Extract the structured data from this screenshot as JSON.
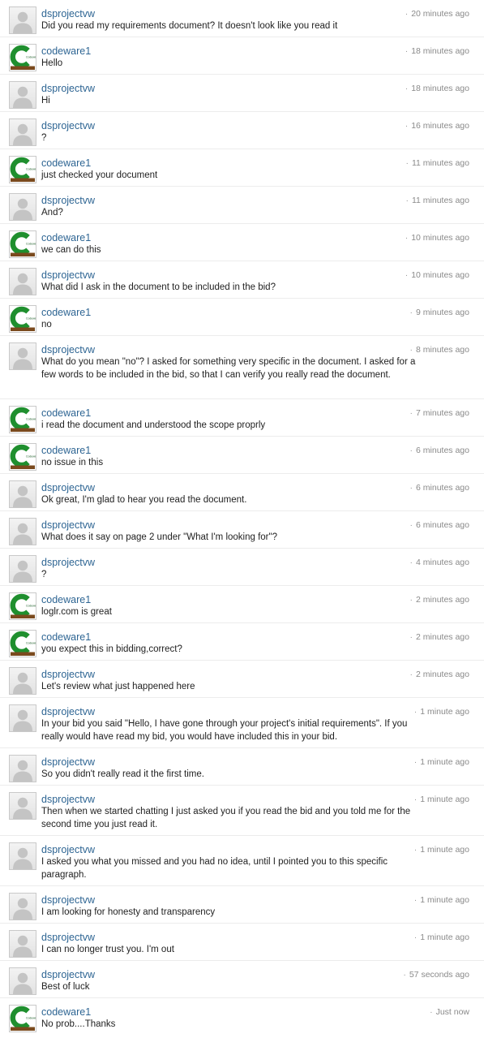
{
  "avatar_icons": {
    "dsprojectvw": "default-user-avatar-icon",
    "codeware1": "codeware-logo-avatar-icon"
  },
  "brand_colors": {
    "username_link": "#2e6593",
    "timestamp": "#8a8a8a",
    "message_text": "#222222",
    "codeware_logo_green": "#1f8f2e",
    "codeware_logo_band": "#7a4a1e"
  },
  "codeware_logo_text": "Codeware",
  "messages": [
    {
      "user": "dsprojectvw",
      "time": "20 minutes ago",
      "text": "Did you read my requirements document? It doesn't look like you read it"
    },
    {
      "user": "codeware1",
      "time": "18 minutes ago",
      "text": "Hello"
    },
    {
      "user": "dsprojectvw",
      "time": "18 minutes ago",
      "text": "Hi"
    },
    {
      "user": "dsprojectvw",
      "time": "16 minutes ago",
      "text": "?"
    },
    {
      "user": "codeware1",
      "time": "11 minutes ago",
      "text": "just checked your document"
    },
    {
      "user": "dsprojectvw",
      "time": "11 minutes ago",
      "text": "And?"
    },
    {
      "user": "codeware1",
      "time": "10 minutes ago",
      "text": "we can do this"
    },
    {
      "user": "dsprojectvw",
      "time": "10 minutes ago",
      "text": "What did I ask in the document to be included in the bid?"
    },
    {
      "user": "codeware1",
      "time": "9 minutes ago",
      "text": "no"
    },
    {
      "user": "dsprojectvw",
      "time": "8 minutes ago",
      "text": "What do you mean \"no\"? I asked for something very specific in the document. I asked for a few words to be included in the bid, so that I can verify you really read the document."
    },
    {
      "user": "codeware1",
      "time": "7 minutes ago",
      "text": "i read the document and understood the scope proprly"
    },
    {
      "user": "codeware1",
      "time": "6 minutes ago",
      "text": "no issue in this"
    },
    {
      "user": "dsprojectvw",
      "time": "6 minutes ago",
      "text": "Ok great, I'm glad to hear you read the document."
    },
    {
      "user": "dsprojectvw",
      "time": "6 minutes ago",
      "text": "What does it say on page 2 under \"What I'm looking for\"?"
    },
    {
      "user": "dsprojectvw",
      "time": "4 minutes ago",
      "text": "?"
    },
    {
      "user": "codeware1",
      "time": "2 minutes ago",
      "text": "loglr.com is great"
    },
    {
      "user": "codeware1",
      "time": "2 minutes ago",
      "text": "you expect this in bidding,correct?"
    },
    {
      "user": "dsprojectvw",
      "time": "2 minutes ago",
      "text": "Let's review what just happened here"
    },
    {
      "user": "dsprojectvw",
      "time": "1 minute ago",
      "text": "In your bid you said \"Hello, I have gone through your project's initial requirements\". If you really would have read my bid, you would have included this in your bid."
    },
    {
      "user": "dsprojectvw",
      "time": "1 minute ago",
      "text": "So you didn't really read it the first time."
    },
    {
      "user": "dsprojectvw",
      "time": "1 minute ago",
      "text": "Then when we started chatting I just asked you if you read the bid and you told me for the second time you just read it."
    },
    {
      "user": "dsprojectvw",
      "time": "1 minute ago",
      "text": "I asked you what you missed and you had no idea, until I pointed you to this specific paragraph."
    },
    {
      "user": "dsprojectvw",
      "time": "1 minute ago",
      "text": "I am looking for honesty and transparency"
    },
    {
      "user": "dsprojectvw",
      "time": "1 minute ago",
      "text": "I can no longer trust you. I'm out"
    },
    {
      "user": "dsprojectvw",
      "time": "57 seconds ago",
      "text": "Best of luck"
    },
    {
      "user": "codeware1",
      "time": "Just now",
      "text": "No prob....Thanks"
    }
  ]
}
